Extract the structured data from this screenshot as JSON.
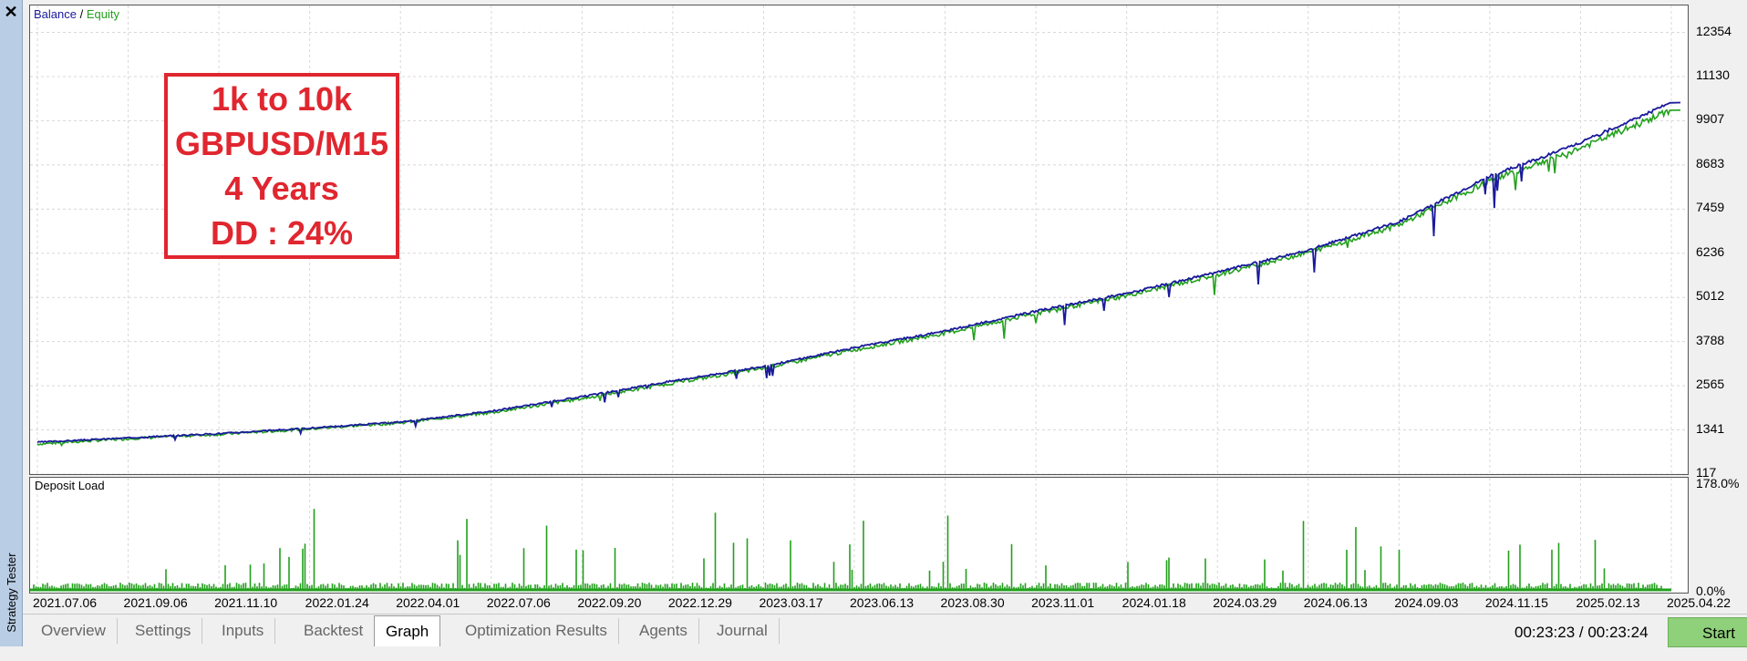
{
  "window": {
    "side_title": "Strategy Tester",
    "close_glyph": "✕"
  },
  "legend": {
    "balance": "Balance",
    "separator": "/",
    "equity": "Equity"
  },
  "annotation": [
    "1k to 10k",
    "GBPUSD/M15",
    "4 Years",
    "DD : 24%"
  ],
  "deposit_load": {
    "label": "Deposit Load",
    "max_label": "178.0%",
    "min_label": "0.0%"
  },
  "colors": {
    "balance": "#1a1a9c",
    "equity": "#22a01c",
    "annotation": "#e0262f",
    "start": "#8fd07a",
    "grid": "#d8d8d8"
  },
  "chart_data": {
    "type": "line",
    "x_labels": [
      "2021.07.06",
      "2021.09.06",
      "2021.11.10",
      "2022.01.24",
      "2022.04.01",
      "2022.07.06",
      "2022.09.20",
      "2022.12.29",
      "2023.03.17",
      "2023.06.13",
      "2023.08.30",
      "2023.11.01",
      "2024.01.18",
      "2024.03.29",
      "2024.06.13",
      "2024.09.03",
      "2024.11.15",
      "2025.02.13",
      "2025.04.22"
    ],
    "y_ticks": [
      117,
      1341,
      2565,
      3788,
      5012,
      6236,
      7459,
      8683,
      9907,
      11130,
      12354
    ],
    "ylim": [
      117,
      13100
    ],
    "series": [
      {
        "name": "Balance",
        "values": [
          1000,
          1120,
          1240,
          1390,
          1560,
          1860,
          2260,
          2700,
          3100,
          3620,
          4080,
          4630,
          5120,
          5710,
          6330,
          7110,
          8370,
          9300,
          10410
        ]
      },
      {
        "name": "Equity",
        "values": [
          950,
          1100,
          1220,
          1370,
          1540,
          1820,
          2210,
          2640,
          3050,
          3560,
          4020,
          4570,
          5060,
          5640,
          6260,
          7020,
          8250,
          9150,
          10200
        ]
      }
    ],
    "deposit_load_range": [
      0,
      178.0
    ]
  },
  "tabs": [
    "Overview",
    "Settings",
    "Inputs",
    "Backtest",
    "Graph",
    "Optimization Results",
    "Agents",
    "Journal"
  ],
  "active_tab": "Graph",
  "timer": "00:23:23 / 00:23:24",
  "start_label": "Start"
}
